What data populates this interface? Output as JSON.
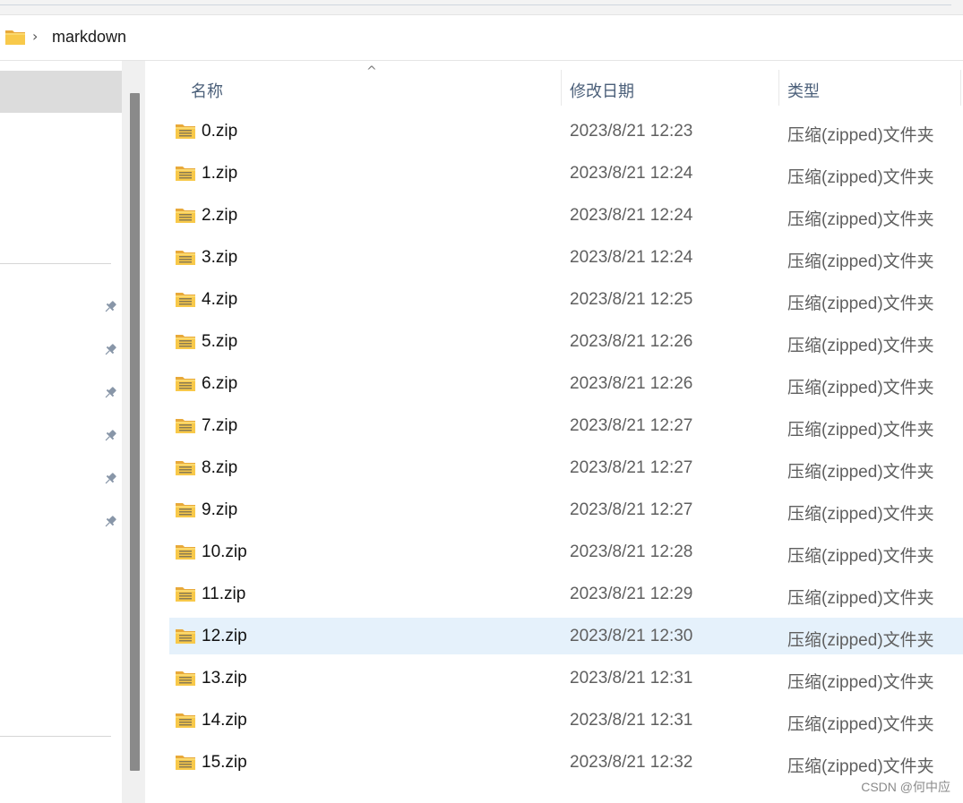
{
  "address": {
    "folder_icon": "folder-icon",
    "separator": "›",
    "path": "markdown"
  },
  "nav": {
    "pins": [
      "pin-icon",
      "pin-icon",
      "pin-icon",
      "pin-icon",
      "pin-icon",
      "pin-icon"
    ]
  },
  "columns": {
    "name": "名称",
    "modified": "修改日期",
    "type": "类型",
    "sort_indicator": "^"
  },
  "files": [
    {
      "name": "0.zip",
      "modified": "2023/8/21 12:23",
      "type": "压缩(zipped)文件夹"
    },
    {
      "name": "1.zip",
      "modified": "2023/8/21 12:24",
      "type": "压缩(zipped)文件夹"
    },
    {
      "name": "2.zip",
      "modified": "2023/8/21 12:24",
      "type": "压缩(zipped)文件夹"
    },
    {
      "name": "3.zip",
      "modified": "2023/8/21 12:24",
      "type": "压缩(zipped)文件夹"
    },
    {
      "name": "4.zip",
      "modified": "2023/8/21 12:25",
      "type": "压缩(zipped)文件夹"
    },
    {
      "name": "5.zip",
      "modified": "2023/8/21 12:26",
      "type": "压缩(zipped)文件夹"
    },
    {
      "name": "6.zip",
      "modified": "2023/8/21 12:26",
      "type": "压缩(zipped)文件夹"
    },
    {
      "name": "7.zip",
      "modified": "2023/8/21 12:27",
      "type": "压缩(zipped)文件夹"
    },
    {
      "name": "8.zip",
      "modified": "2023/8/21 12:27",
      "type": "压缩(zipped)文件夹"
    },
    {
      "name": "9.zip",
      "modified": "2023/8/21 12:27",
      "type": "压缩(zipped)文件夹"
    },
    {
      "name": "10.zip",
      "modified": "2023/8/21 12:28",
      "type": "压缩(zipped)文件夹"
    },
    {
      "name": "11.zip",
      "modified": "2023/8/21 12:29",
      "type": "压缩(zipped)文件夹"
    },
    {
      "name": "12.zip",
      "modified": "2023/8/21 12:30",
      "type": "压缩(zipped)文件夹",
      "selected": true
    },
    {
      "name": "13.zip",
      "modified": "2023/8/21 12:31",
      "type": "压缩(zipped)文件夹"
    },
    {
      "name": "14.zip",
      "modified": "2023/8/21 12:31",
      "type": "压缩(zipped)文件夹"
    },
    {
      "name": "15.zip",
      "modified": "2023/8/21 12:32",
      "type": "压缩(zipped)文件夹"
    }
  ],
  "watermark": "CSDN @何中应",
  "colors": {
    "selection": "#e5f1fb",
    "header_text": "#4c607a",
    "folder_yellow": "#f8c94a"
  }
}
